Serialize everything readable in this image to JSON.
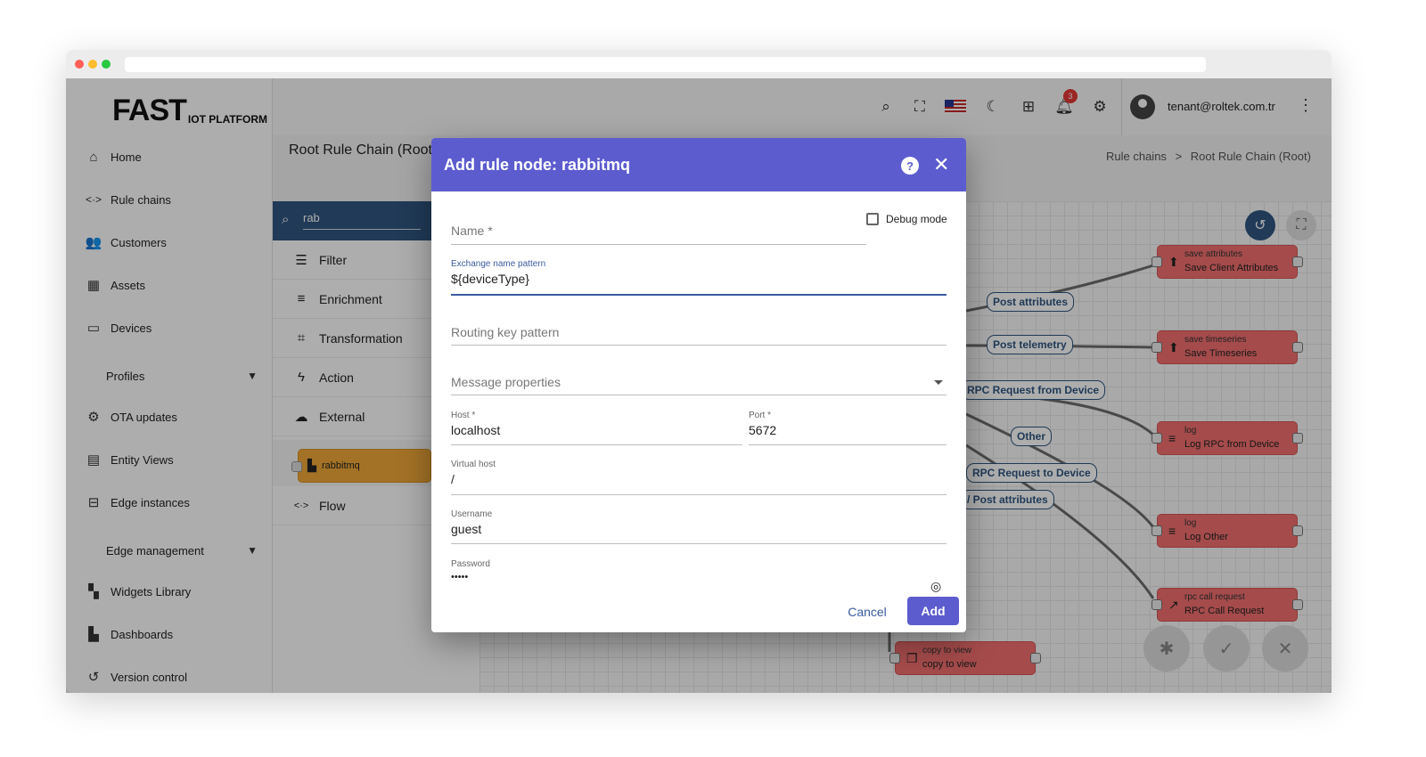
{
  "logo": {
    "main": "FAST",
    "sub": "IOT PLATFORM"
  },
  "sidebar": {
    "items": [
      {
        "label": "Home",
        "icon": "home-icon"
      },
      {
        "label": "Rule chains",
        "icon": "code-arrows-icon"
      },
      {
        "label": "Customers",
        "icon": "people-icon"
      },
      {
        "label": "Assets",
        "icon": "building-icon"
      },
      {
        "label": "Devices",
        "icon": "devices-icon"
      },
      {
        "label": "Profiles",
        "icon": ""
      },
      {
        "label": "OTA updates",
        "icon": "chip-gear-icon"
      },
      {
        "label": "Entity Views",
        "icon": "view-grid-icon"
      },
      {
        "label": "Edge instances",
        "icon": "router-icon"
      },
      {
        "label": "Edge management",
        "icon": ""
      },
      {
        "label": "Widgets Library",
        "icon": "widgets-icon"
      },
      {
        "label": "Dashboards",
        "icon": "dashboard-icon"
      },
      {
        "label": "Version control",
        "icon": "history-icon"
      }
    ]
  },
  "topbar": {
    "notification_count": "3",
    "user_email": "tenant@roltek.com.tr"
  },
  "page": {
    "title": "Root Rule Chain (Root)",
    "breadcrumb": [
      "Rule chains",
      ">",
      "Root Rule Chain (Root)"
    ]
  },
  "library": {
    "search_value": "rab",
    "categories": [
      "Filter",
      "Enrichment",
      "Transformation",
      "Action",
      "External",
      "Flow"
    ],
    "node_label": "rabbitmq"
  },
  "canvas": {
    "nodes": [
      {
        "type": "save attributes",
        "name": "Save Client Attributes",
        "icon": "upload-icon"
      },
      {
        "type": "save timeseries",
        "name": "Save Timeseries",
        "icon": "upload-icon"
      },
      {
        "type": "log",
        "name": "Log RPC from Device",
        "icon": "menu-icon"
      },
      {
        "type": "log",
        "name": "Log Other",
        "icon": "menu-icon"
      },
      {
        "type": "rpc call request",
        "name": "RPC Call Request",
        "icon": "arrow-up-right-icon"
      },
      {
        "type": "copy to view",
        "name": "copy to view",
        "icon": "copy-icon"
      }
    ],
    "edge_labels": [
      "Post attributes",
      "Post telemetry",
      "RPC Request from Device",
      "Other",
      "RPC Request to Device",
      "/ Post attributes"
    ]
  },
  "dialog": {
    "title": "Add rule node: rabbitmq",
    "debug_label": "Debug mode",
    "name_placeholder": "Name *",
    "exchange_label": "Exchange name pattern",
    "exchange_value": "${deviceType}",
    "routing_placeholder": "Routing key pattern",
    "message_props_placeholder": "Message properties",
    "host_label": "Host *",
    "host_value": "localhost",
    "port_label": "Port *",
    "port_value": "5672",
    "vhost_label": "Virtual host",
    "vhost_value": "/",
    "username_label": "Username",
    "username_value": "guest",
    "password_label": "Password",
    "password_value": "•••••",
    "cancel_label": "Cancel",
    "add_label": "Add"
  },
  "colors": {
    "dialog_header": "#5c5ccf",
    "primary": "#305680",
    "node_red": "#f36f6f",
    "node_orange": "#f0a938"
  }
}
